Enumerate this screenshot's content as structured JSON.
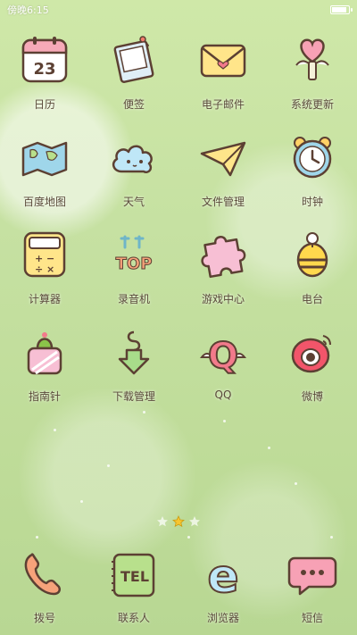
{
  "status_bar": {
    "carrier": "傍晚6:15",
    "battery_percent": 95
  },
  "home": {
    "apps": [
      {
        "label": "日历",
        "icon": "calendar-icon",
        "calendar_day": "23"
      },
      {
        "label": "便签",
        "icon": "notes-icon"
      },
      {
        "label": "电子邮件",
        "icon": "mail-icon"
      },
      {
        "label": "系统更新",
        "icon": "heart-balloon-icon"
      },
      {
        "label": "百度地图",
        "icon": "map-icon"
      },
      {
        "label": "天气",
        "icon": "cloud-icon"
      },
      {
        "label": "文件管理",
        "icon": "paper-plane-icon"
      },
      {
        "label": "时钟",
        "icon": "alarm-clock-icon"
      },
      {
        "label": "计算器",
        "icon": "calculator-icon"
      },
      {
        "label": "录音机",
        "icon": "recorder-icon",
        "icon_text": "TOP"
      },
      {
        "label": "游戏中心",
        "icon": "puzzle-icon"
      },
      {
        "label": "电台",
        "icon": "bee-radio-icon"
      },
      {
        "label": "指南针",
        "icon": "cactus-icon"
      },
      {
        "label": "下载管理",
        "icon": "download-arrow-icon"
      },
      {
        "label": "QQ",
        "icon": "qq-icon",
        "icon_text": "Q"
      },
      {
        "label": "微博",
        "icon": "weibo-icon"
      }
    ],
    "pages": 3,
    "current_page": 2
  },
  "dock": [
    {
      "label": "拨号",
      "icon": "phone-icon"
    },
    {
      "label": "联系人",
      "icon": "contacts-icon",
      "icon_text": "TEL"
    },
    {
      "label": "浏览器",
      "icon": "browser-icon",
      "icon_text": "e"
    },
    {
      "label": "短信",
      "icon": "message-icon"
    }
  ],
  "colors": {
    "text": "#5a4a3a",
    "outline": "#5c4033",
    "pink": "#f6a9b8",
    "yellow": "#ffe58a",
    "page_dot_active": "#f7c531"
  }
}
